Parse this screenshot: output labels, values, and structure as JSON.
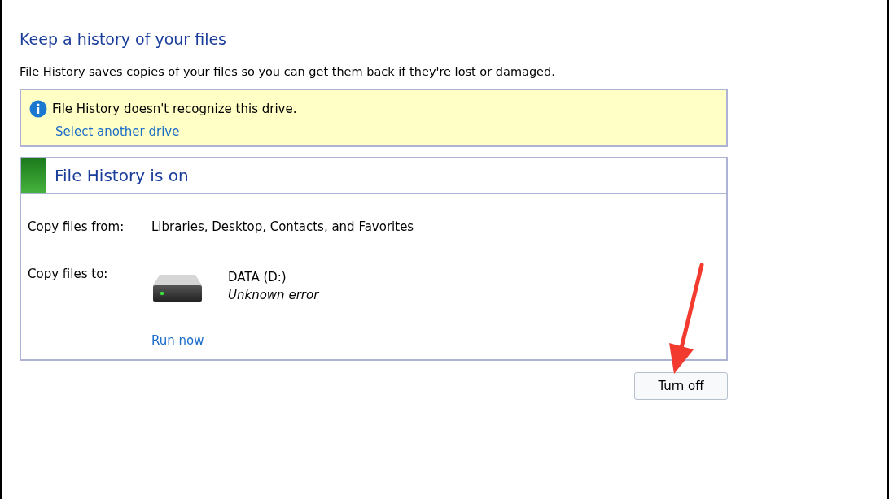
{
  "title": "Keep a history of your files",
  "description": "File History saves copies of your files so you can get them back if they're lost or damaged.",
  "notice": {
    "message": "File History doesn't recognize this drive.",
    "link": "Select another drive"
  },
  "status_panel": {
    "heading": "File History is on",
    "on": true,
    "copy_from": {
      "label": "Copy files from:",
      "value": "Libraries, Desktop, Contacts, and Favorites"
    },
    "copy_to": {
      "label": "Copy files to:",
      "drive_name": "DATA (D:)",
      "drive_status": "Unknown error"
    },
    "run_link": "Run now"
  },
  "buttons": [
    "Turn off"
  ]
}
